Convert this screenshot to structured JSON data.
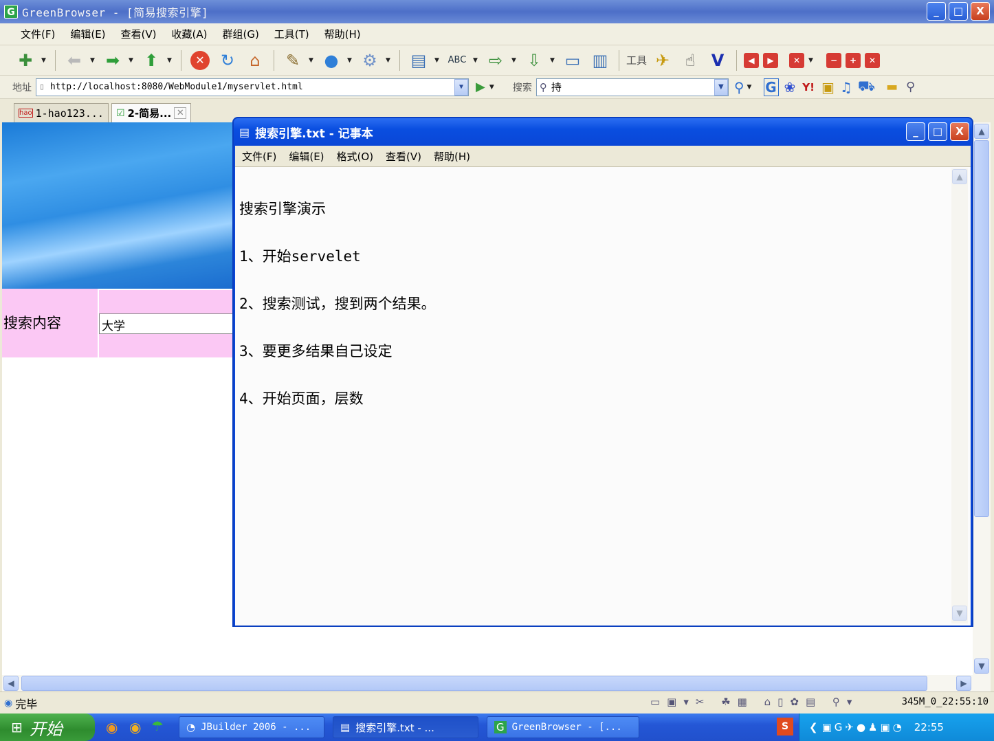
{
  "browser": {
    "title": "GreenBrowser - [简易搜索引擎]",
    "app_icon": "G",
    "window_buttons": [
      "_",
      "□",
      "X"
    ],
    "menu": [
      "文件(F)",
      "编辑(E)",
      "查看(V)",
      "收藏(A)",
      "群组(G)",
      "工具(T)",
      "帮助(H)"
    ],
    "toolbar_tools_label": "工具",
    "address_label": "地址",
    "address_value": "http://localhost:8080/WebModule1/myservlet.html",
    "search_label": "搜索",
    "search_value": "持",
    "tabs": [
      {
        "label": "1-hao123..."
      },
      {
        "label": "2-简易..."
      }
    ],
    "status_text": "完毕",
    "status_right": "345M_0_22:55:10"
  },
  "page": {
    "search_label": "搜索内容",
    "search_value": "大学"
  },
  "notepad": {
    "title": "搜索引擎.txt - 记事本",
    "menu": [
      "文件(F)",
      "编辑(E)",
      "格式(O)",
      "查看(V)",
      "帮助(H)"
    ],
    "lines": [
      "搜索引擎演示",
      "1、开始servelet",
      "2、搜索测试，搜到两个结果。",
      "3、要更多结果自己设定",
      "4、开始页面，层数"
    ]
  },
  "taskbar": {
    "start_label": "开始",
    "tasks": [
      {
        "label": "JBuilder 2006 - ..."
      },
      {
        "label": "搜索引擎.txt - ..."
      },
      {
        "label": "GreenBrowser - [..."
      }
    ],
    "clock": "22:55"
  },
  "colors": {
    "page_banner": "#2f8ee3",
    "search_row_bg": "#fbc8f4",
    "notepad_frame": "#0a46d6"
  }
}
